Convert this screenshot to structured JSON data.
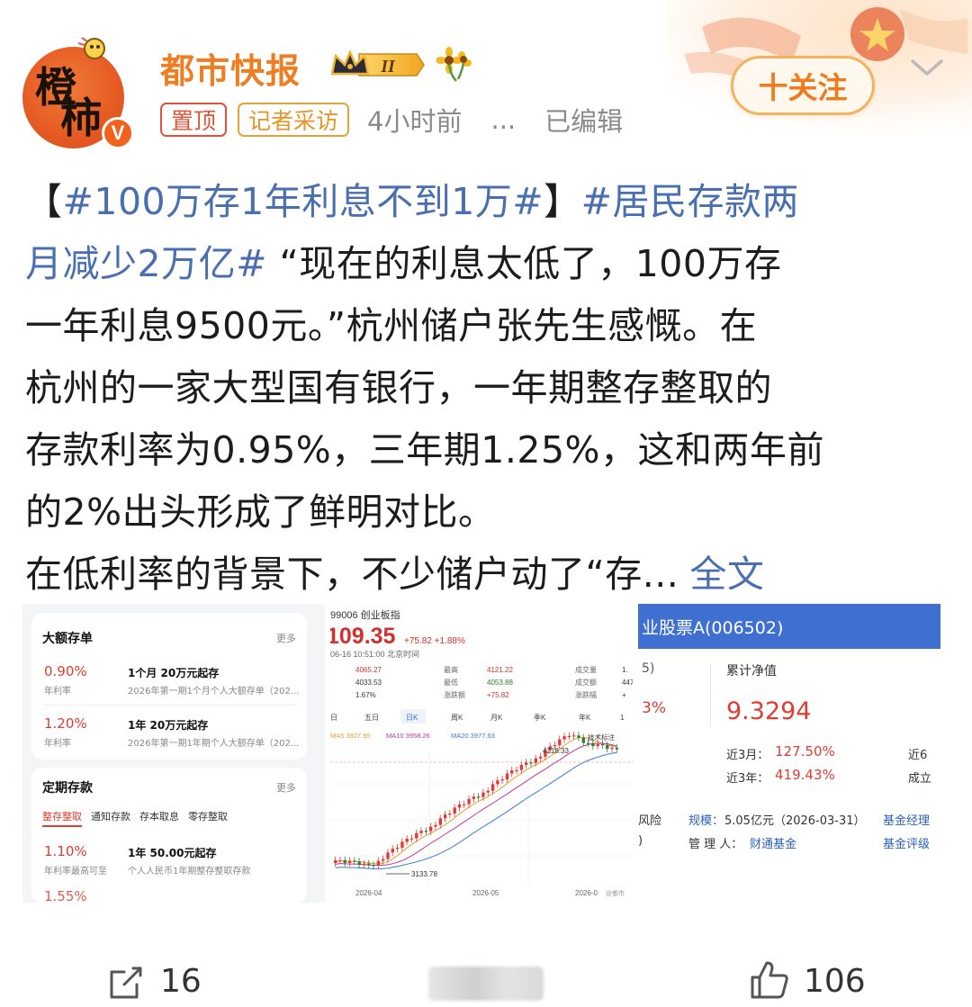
{
  "post": {
    "author": {
      "name": "都市快报",
      "avatar_chars": [
        "橙",
        "柿"
      ],
      "verified_mark": "V",
      "member_level": "II"
    },
    "tags": [
      "置顶",
      "记者采访"
    ],
    "time": "4小时前",
    "dots": "...",
    "edited": "已编辑",
    "follow_label": "十关注",
    "text": {
      "bracket_open": "【",
      "topic1": "#100万存1年利息不到1万#",
      "bracket_close": "】",
      "topic2_a": "#居民存款两",
      "topic2_b": "月减少2万亿#",
      "line2_rest": " “现在的利息太低了，100万存",
      "line3": "一年利息9500元。”杭州储户张先生感慨。在",
      "line4": "杭州的一家大型国有银行，一年期整存整取的",
      "line5": "存款利率为0.95%，三年期1.25%，这和两年前",
      "line6": "的2%出头形成了鲜明对比。",
      "line7": "在低利率的背景下，不少储户动了“存...",
      "more_label": "全文"
    }
  },
  "images": {
    "deposit_screen": {
      "card1_title": "大额存单",
      "more": "更多",
      "rows1": [
        {
          "rate": "0.90%",
          "rate_label": "年利率",
          "product": "1个月 20万元起存",
          "desc": "2026年第一期1个月个人大额存单（202..."
        },
        {
          "rate": "1.20%",
          "rate_label": "年利率",
          "product": "1年 20万元起存",
          "desc": "2026年第一期1年期个人大额存单（202..."
        }
      ],
      "card2_title": "定期存款",
      "tabs": [
        "整存整取",
        "通知存款",
        "存本取息",
        "零存整取"
      ],
      "rows2": [
        {
          "rate": "1.10%",
          "rate_label": "年利率最高可至",
          "product": "1年 50.00元起存",
          "desc": "个人人民币1年期整存整取存款"
        }
      ],
      "partial_rate": "1.55%"
    },
    "index_screen": {
      "code_name": "99006 创业板指",
      "price": "109.35",
      "change": "+75.82 +1.88%",
      "datetime": "06-16 10:51:00 北京时间",
      "stats_left": [
        "4065.27",
        "4033.53",
        "1.67%"
      ],
      "stats_mid_labels": [
        "最高",
        "最低",
        "涨跌额"
      ],
      "stats_mid_values": [
        "4121.22",
        "4053.88",
        "+75.82"
      ],
      "stats_right_labels": [
        "成交量",
        "成交额",
        "涨跌幅"
      ],
      "stats_right_values": [
        "1.",
        "447",
        "+"
      ],
      "periods": [
        "日",
        "五日",
        "日K",
        "周K",
        "月K",
        "季K",
        "年K",
        "1"
      ],
      "ma": [
        "MA5 3927.95",
        "MA10 3958.26",
        "MA20 3977.63"
      ],
      "high_label": "4218.33",
      "low_label": "3133.78",
      "tech_label": "技术标注",
      "dates": [
        "2026-04",
        "2026-05",
        "2026-0"
      ],
      "watermark": "@都市"
    },
    "fund_screen": {
      "title": "业股票A(006502)",
      "partial_left_top": "5)",
      "partial_left_pct": "3%",
      "nav_label": "累计净值",
      "nav_value": "9.3294",
      "m3_label": "近3月：",
      "m3_value": "127.50%",
      "y3_label": "近3年：",
      "y3_value": "419.43%",
      "right_partial1": "近6",
      "right_partial2": "成立",
      "risk_label": "风险",
      "scale_label": "规模：",
      "scale_value": "5.05亿元（2026-03-31）",
      "manager_label": "管 理 人：",
      "manager_value": "财通基金",
      "right_link1": "基金经理",
      "right_link2": "基金评级",
      "left_partial": ")"
    }
  },
  "footer": {
    "share_count": "16",
    "like_count": "106"
  },
  "colors": {
    "author_orange": "#ef7d22",
    "topic_blue": "#4a6fb0",
    "rate_red": "#e03c31",
    "fund_header_blue": "#3e6fd1"
  }
}
